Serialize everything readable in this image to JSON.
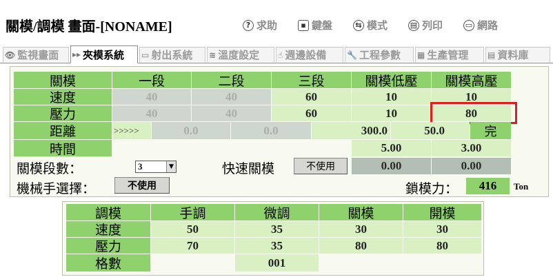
{
  "window": {
    "title": "關模/調模 畫面-[NONAME]"
  },
  "toolbar": [
    {
      "icon": "help-icon",
      "label": "求助"
    },
    {
      "icon": "keyboard-icon",
      "label": "鍵盤"
    },
    {
      "icon": "mode-icon",
      "label": "模式"
    },
    {
      "icon": "print-icon",
      "label": "列印"
    },
    {
      "icon": "network-icon",
      "label": "網路"
    }
  ],
  "tabs": [
    {
      "label": "監視畫面",
      "icon": "eye-icon"
    },
    {
      "label": "夾模系統",
      "icon": "clamp-icon",
      "active": true
    },
    {
      "label": "射出系統",
      "icon": "injection-icon"
    },
    {
      "label": "溫度設定",
      "icon": "temperature-icon"
    },
    {
      "label": "週邊設備",
      "icon": "peripheral-icon"
    },
    {
      "label": "工程參數",
      "icon": "wrench-icon"
    },
    {
      "label": "生產管理",
      "icon": "production-icon"
    },
    {
      "label": "資料庫",
      "icon": "database-icon"
    }
  ],
  "mold_close": {
    "header": [
      "關模",
      "一段",
      "二段",
      "三段",
      "關模低壓",
      "關模高壓"
    ],
    "speed": {
      "label": "速度",
      "values": [
        "40",
        "40",
        "60",
        "10",
        "10"
      ]
    },
    "pressure": {
      "label": "壓力",
      "values": [
        "40",
        "40",
        "60",
        "10",
        "80"
      ]
    },
    "distance": {
      "label": "距離",
      "marker": ">>>>>",
      "values": [
        "0.0",
        "0.0",
        "300.0",
        "50.0"
      ],
      "status": "完"
    },
    "time": {
      "label": "時間",
      "values": [
        "5.00",
        "3.00"
      ]
    },
    "stage_count": {
      "label": "關模段數：",
      "value": "3"
    },
    "fast_close": {
      "label": "快速關模",
      "button": "不使用",
      "readings": [
        "0.00",
        "0.00"
      ]
    },
    "robot": {
      "label": "機械手選擇：",
      "button": "不使用"
    },
    "clamp_force": {
      "label": "鎖模力：",
      "value": "416",
      "unit": "Ton"
    }
  },
  "mold_adjust": {
    "header": [
      "調模",
      "手調",
      "微調",
      "關模",
      "開模"
    ],
    "speed": {
      "label": "速度",
      "values": [
        "50",
        "35",
        "30",
        "30"
      ]
    },
    "pressure": {
      "label": "壓力",
      "values": [
        "70",
        "35",
        "80",
        "80"
      ]
    },
    "count": {
      "label": "格數",
      "value": "001"
    }
  },
  "colors": {
    "header": "#8ed16d",
    "cell": "#d8f0c2",
    "disabled": "#cfd5cf",
    "highlight": "#e31c1c"
  }
}
